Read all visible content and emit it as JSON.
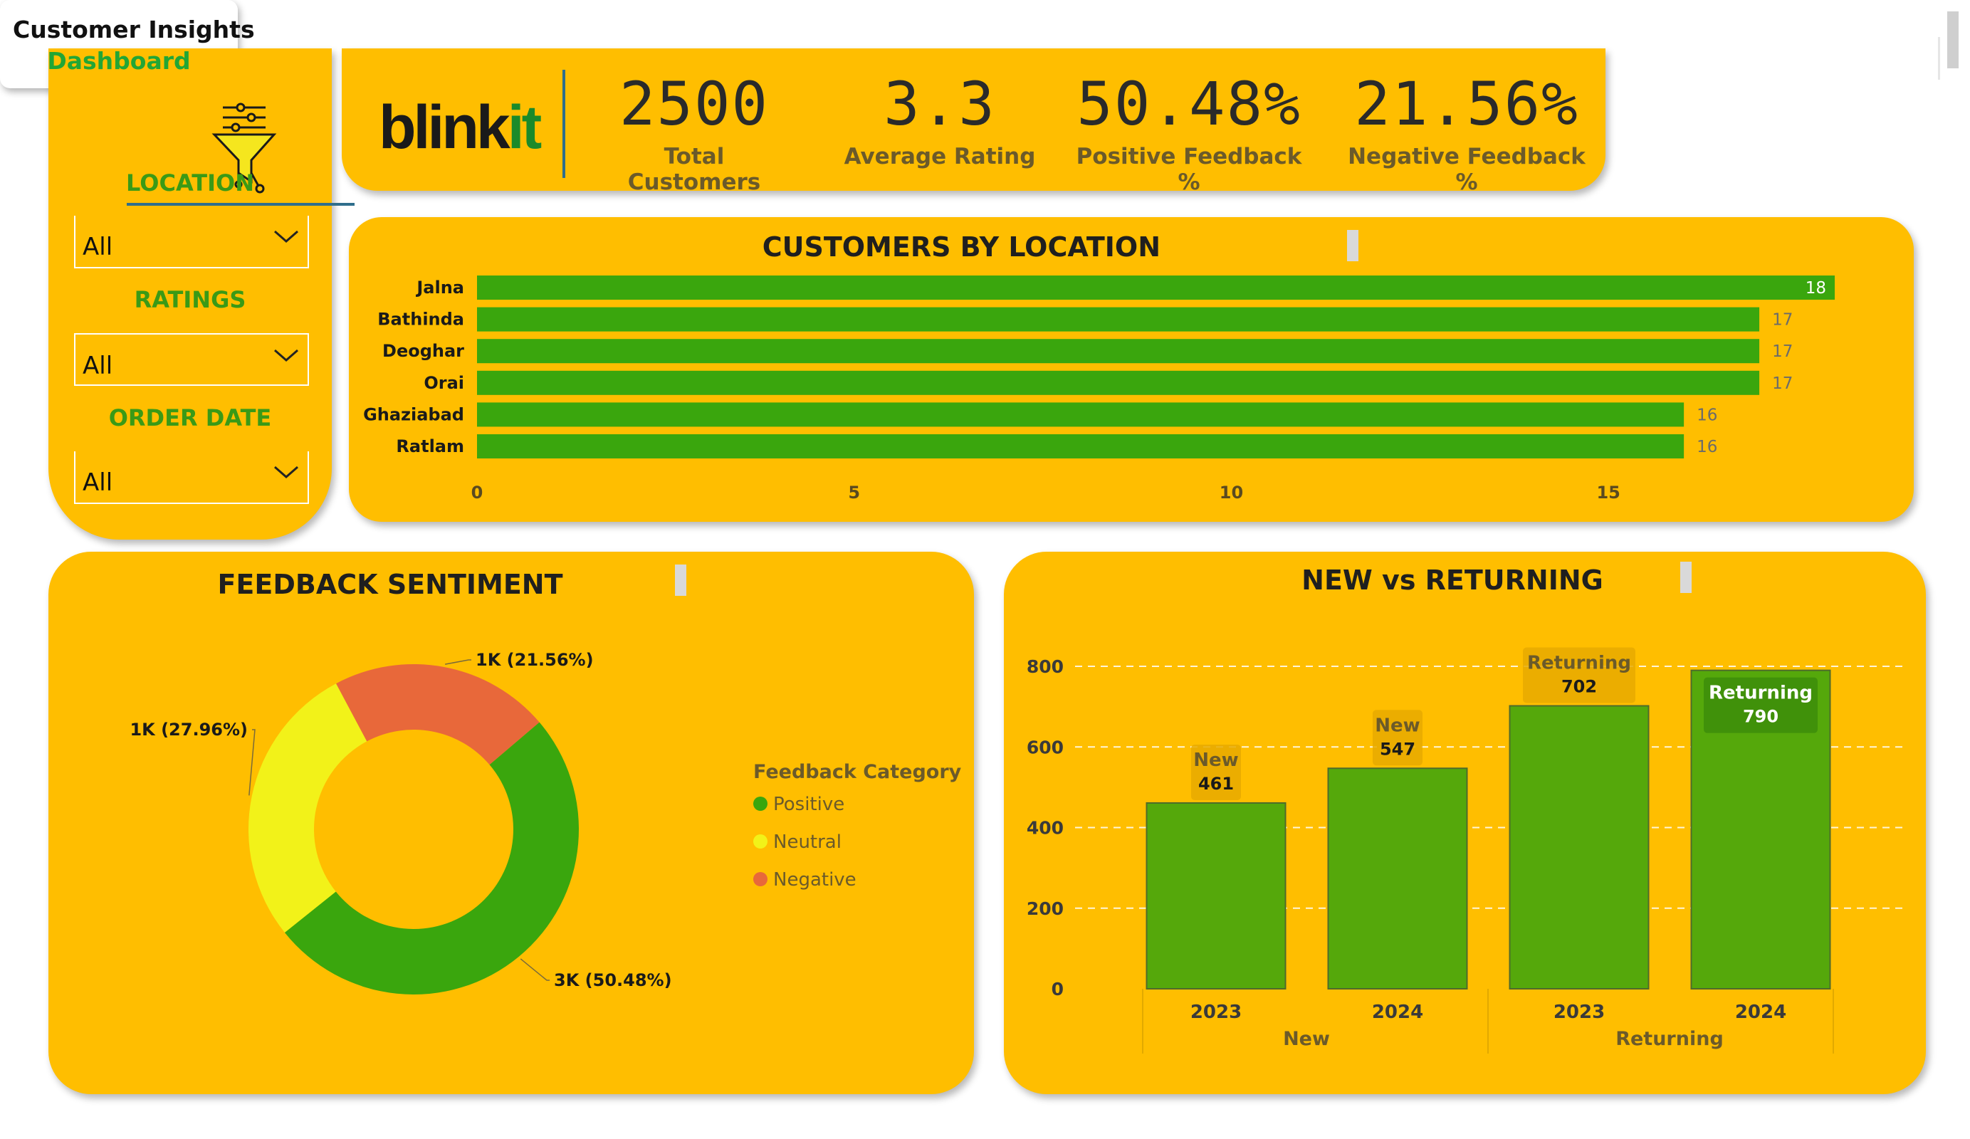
{
  "filters": {
    "items": [
      {
        "label": "LOCATION",
        "value": "All"
      },
      {
        "label": "RATINGS",
        "value": "All"
      },
      {
        "label": "ORDER DATE",
        "value": "All"
      }
    ],
    "icon": "funnel-filter-icon"
  },
  "brand": {
    "logo_left": "blink",
    "logo_right": "it"
  },
  "kpis": [
    {
      "value": "2500",
      "label": "Total Customers"
    },
    {
      "value": "3.3",
      "label": "Average Rating"
    },
    {
      "value": "50.48%",
      "label": "Positive Feedback %"
    },
    {
      "value": "21.56%",
      "label": "Negative Feedback %"
    }
  ],
  "title_card": {
    "line1": "Customer Insights",
    "line2": "Dashboard"
  },
  "colors": {
    "background": "#FFBE00",
    "bar_green": "#3AA60D",
    "positive": "#3AA60D",
    "neutral": "#F2F219",
    "negative": "#E8683A",
    "accent_green": "#22A635"
  },
  "chart_data": [
    {
      "type": "bar",
      "orientation": "horizontal",
      "title": "CUSTOMERS BY LOCATION",
      "categories": [
        "Jalna",
        "Bathinda",
        "Deoghar",
        "Orai",
        "Ghaziabad",
        "Ratlam"
      ],
      "values": [
        18,
        17,
        17,
        17,
        16,
        16
      ],
      "xticks": [
        "0",
        "5",
        "10",
        "15"
      ],
      "xlim": [
        0,
        18.5
      ],
      "grid": false
    },
    {
      "type": "pie",
      "donut": true,
      "title": "FEEDBACK SENTIMENT",
      "legend_title": "Feedback Category",
      "legend_position": "right",
      "slices": [
        {
          "name": "Positive",
          "value": 50.48,
          "label": "3K (50.48%)"
        },
        {
          "name": "Neutral",
          "value": 27.96,
          "label": "1K (27.96%)"
        },
        {
          "name": "Negative",
          "value": 21.56,
          "label": "1K (21.56%)"
        }
      ]
    },
    {
      "type": "bar",
      "title": "NEW vs RETURNING",
      "groups": [
        "New",
        "Returning"
      ],
      "bars": [
        {
          "group": "New",
          "year": "2023",
          "value": 461,
          "tag": "New"
        },
        {
          "group": "New",
          "year": "2024",
          "value": 547,
          "tag": "New"
        },
        {
          "group": "Returning",
          "year": "2023",
          "value": 702,
          "tag": "Returning"
        },
        {
          "group": "Returning",
          "year": "2024",
          "value": 790,
          "tag": "Returning"
        }
      ],
      "yticks": [
        "0",
        "200",
        "400",
        "600",
        "800"
      ],
      "ylim": [
        0,
        800
      ],
      "grid": true
    }
  ]
}
